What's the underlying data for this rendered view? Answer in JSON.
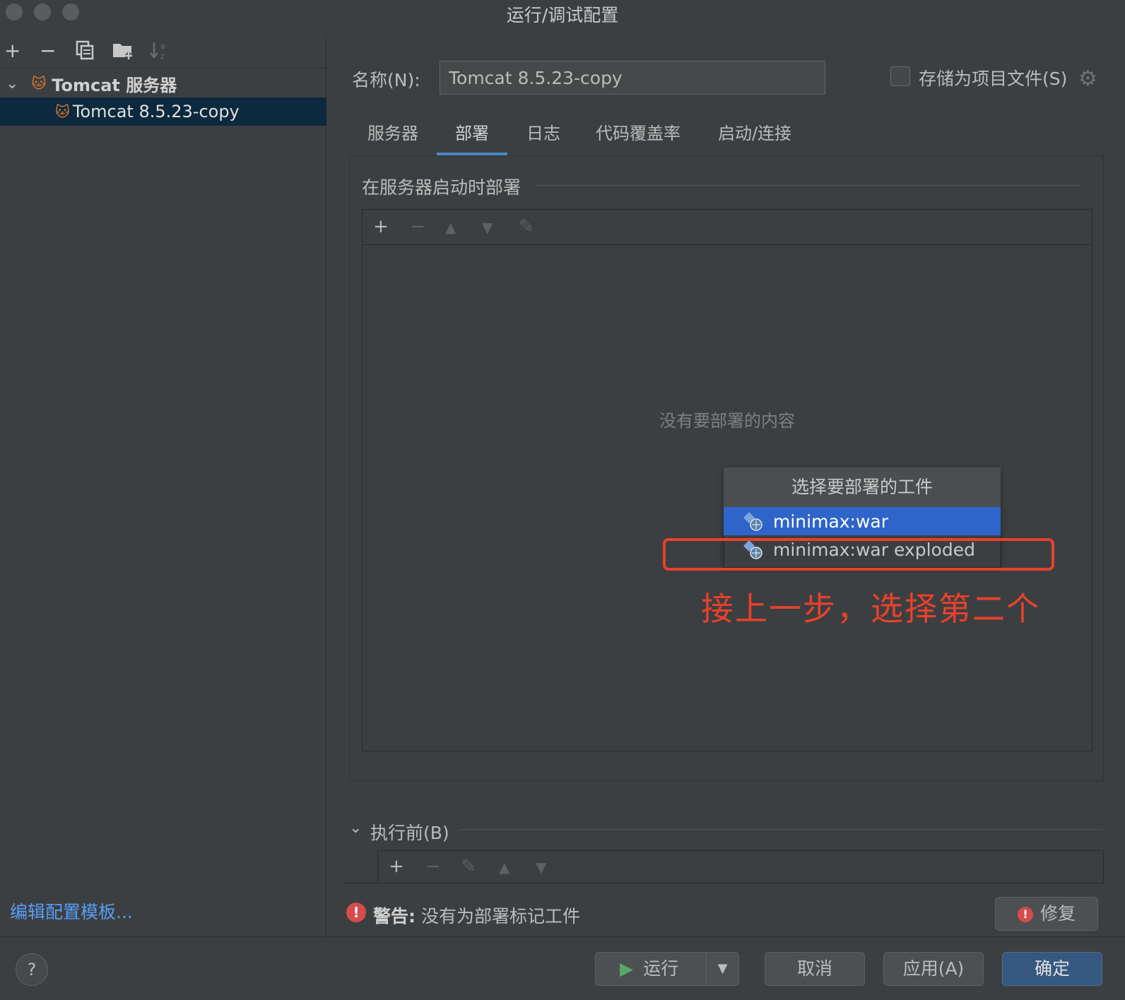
{
  "window": {
    "title": "运行/调试配置"
  },
  "left": {
    "tree": {
      "group_label": "Tomcat 服务器",
      "item_label": "Tomcat 8.5.23-copy"
    },
    "edit_template_link": "编辑配置模板..."
  },
  "form": {
    "name_label": "名称(N):",
    "name_value": "Tomcat 8.5.23-copy",
    "store_as_project_file_label": "存储为项目文件(S)",
    "store_as_project_file_checked": false
  },
  "tabs": [
    "服务器",
    "部署",
    "日志",
    "代码覆盖率",
    "启动/连接"
  ],
  "active_tab": "部署",
  "deploy": {
    "section_title": "在服务器启动时部署",
    "empty_text": "没有要部署的内容"
  },
  "popup": {
    "title": "选择要部署的工件",
    "items": [
      "minimax:war",
      "minimax:war exploded"
    ],
    "selected_index": 0
  },
  "annotation": "接上一步，选择第二个",
  "before_launch": {
    "label": "执行前(B)"
  },
  "warning": {
    "prefix": "警告:",
    "text": "没有为部署标记工件"
  },
  "buttons": {
    "fix": "修复",
    "run": "运行",
    "cancel": "取消",
    "apply": "应用(A)",
    "ok": "确定",
    "help": "?"
  },
  "colors": {
    "background": "#3c3f41",
    "selection_tree": "#0d293e",
    "selection_popup": "#2f65ca",
    "tab_underline": "#4a88c7",
    "annotation_red": "#e8412c",
    "link_blue": "#589df6",
    "primary_button": "#365880"
  }
}
